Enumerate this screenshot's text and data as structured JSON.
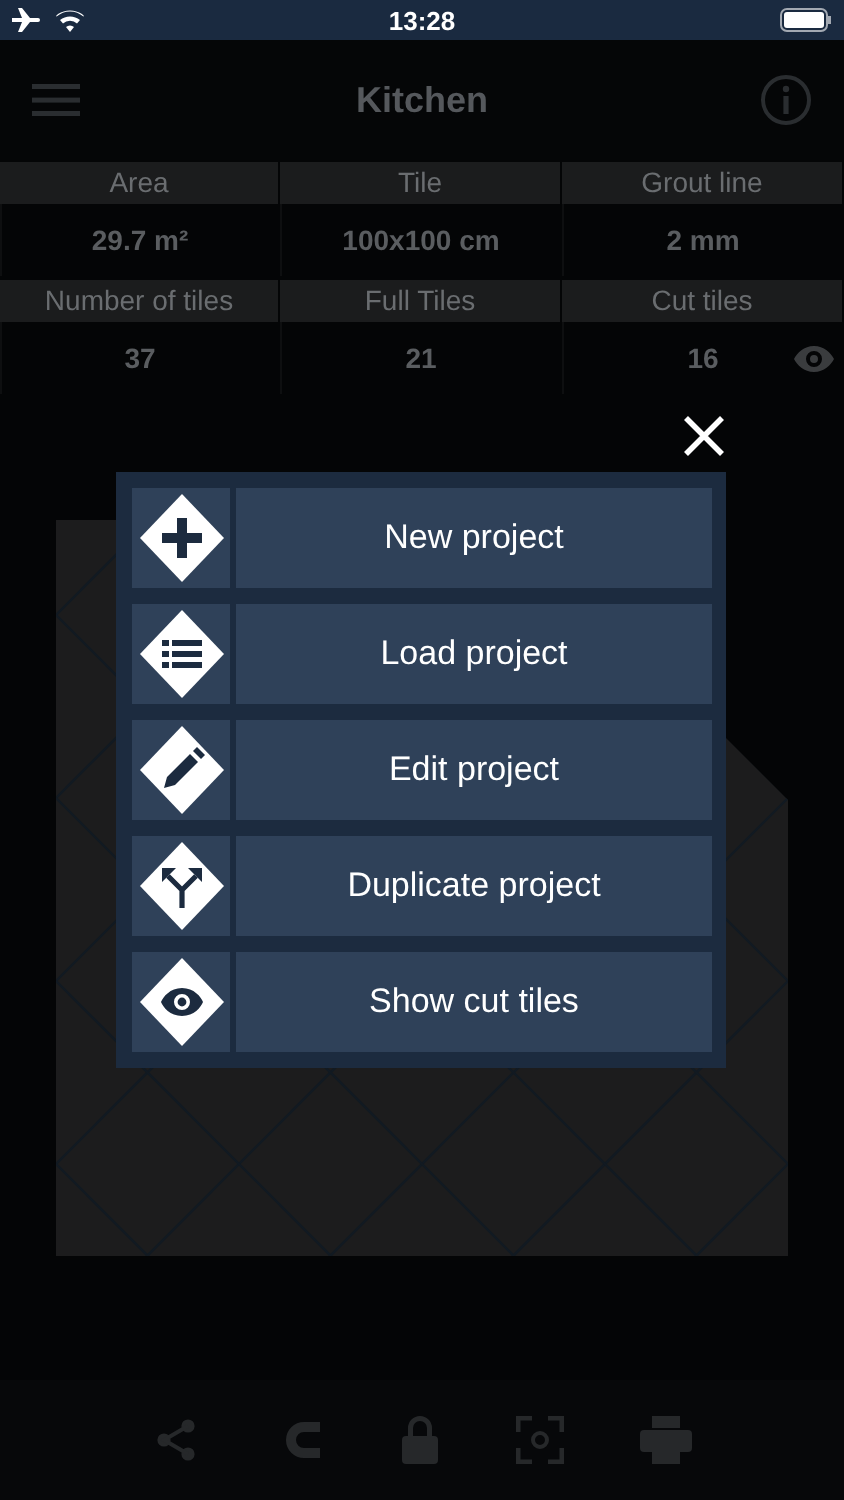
{
  "status_bar": {
    "time": "13:28"
  },
  "nav": {
    "title": "Kitchen"
  },
  "summary": {
    "rows": [
      {
        "cells": [
          {
            "label": "Area",
            "value": "29.7 m²"
          },
          {
            "label": "Tile",
            "value": "100x100 cm"
          },
          {
            "label": "Grout line",
            "value": "2 mm"
          }
        ]
      },
      {
        "cells": [
          {
            "label": "Number of tiles",
            "value": "37"
          },
          {
            "label": "Full Tiles",
            "value": "21"
          },
          {
            "label": "Cut tiles",
            "value": "16",
            "eye": true
          }
        ]
      }
    ]
  },
  "menu": {
    "items": [
      {
        "label": "New project",
        "kind": "plus"
      },
      {
        "label": "Load project",
        "kind": "list"
      },
      {
        "label": "Edit project",
        "kind": "pencil"
      },
      {
        "label": "Duplicate project",
        "kind": "branch"
      },
      {
        "label": "Show cut tiles",
        "kind": "eye"
      }
    ]
  }
}
